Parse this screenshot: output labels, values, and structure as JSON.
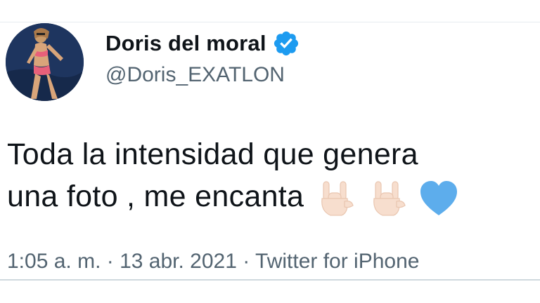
{
  "user": {
    "display_name": "Doris del moral",
    "handle": "@Doris_EXATLON",
    "verified": true,
    "avatar_icon": "profile-photo"
  },
  "tweet": {
    "line1": "Toda la intensidad que genera",
    "line2": "una foto , me encanta",
    "emojis": [
      "sign-of-horns-icon",
      "sign-of-horns-icon",
      "blue-heart-icon"
    ]
  },
  "meta": {
    "time": "1:05 a. m.",
    "separator1": " · ",
    "date": "13 abr. 2021",
    "separator2": " · ",
    "source": "Twitter for iPhone"
  },
  "colors": {
    "verified_blue": "#1d9bf0",
    "heart_blue": "#5dadec",
    "text": "#0f1419",
    "secondary": "#536471"
  }
}
